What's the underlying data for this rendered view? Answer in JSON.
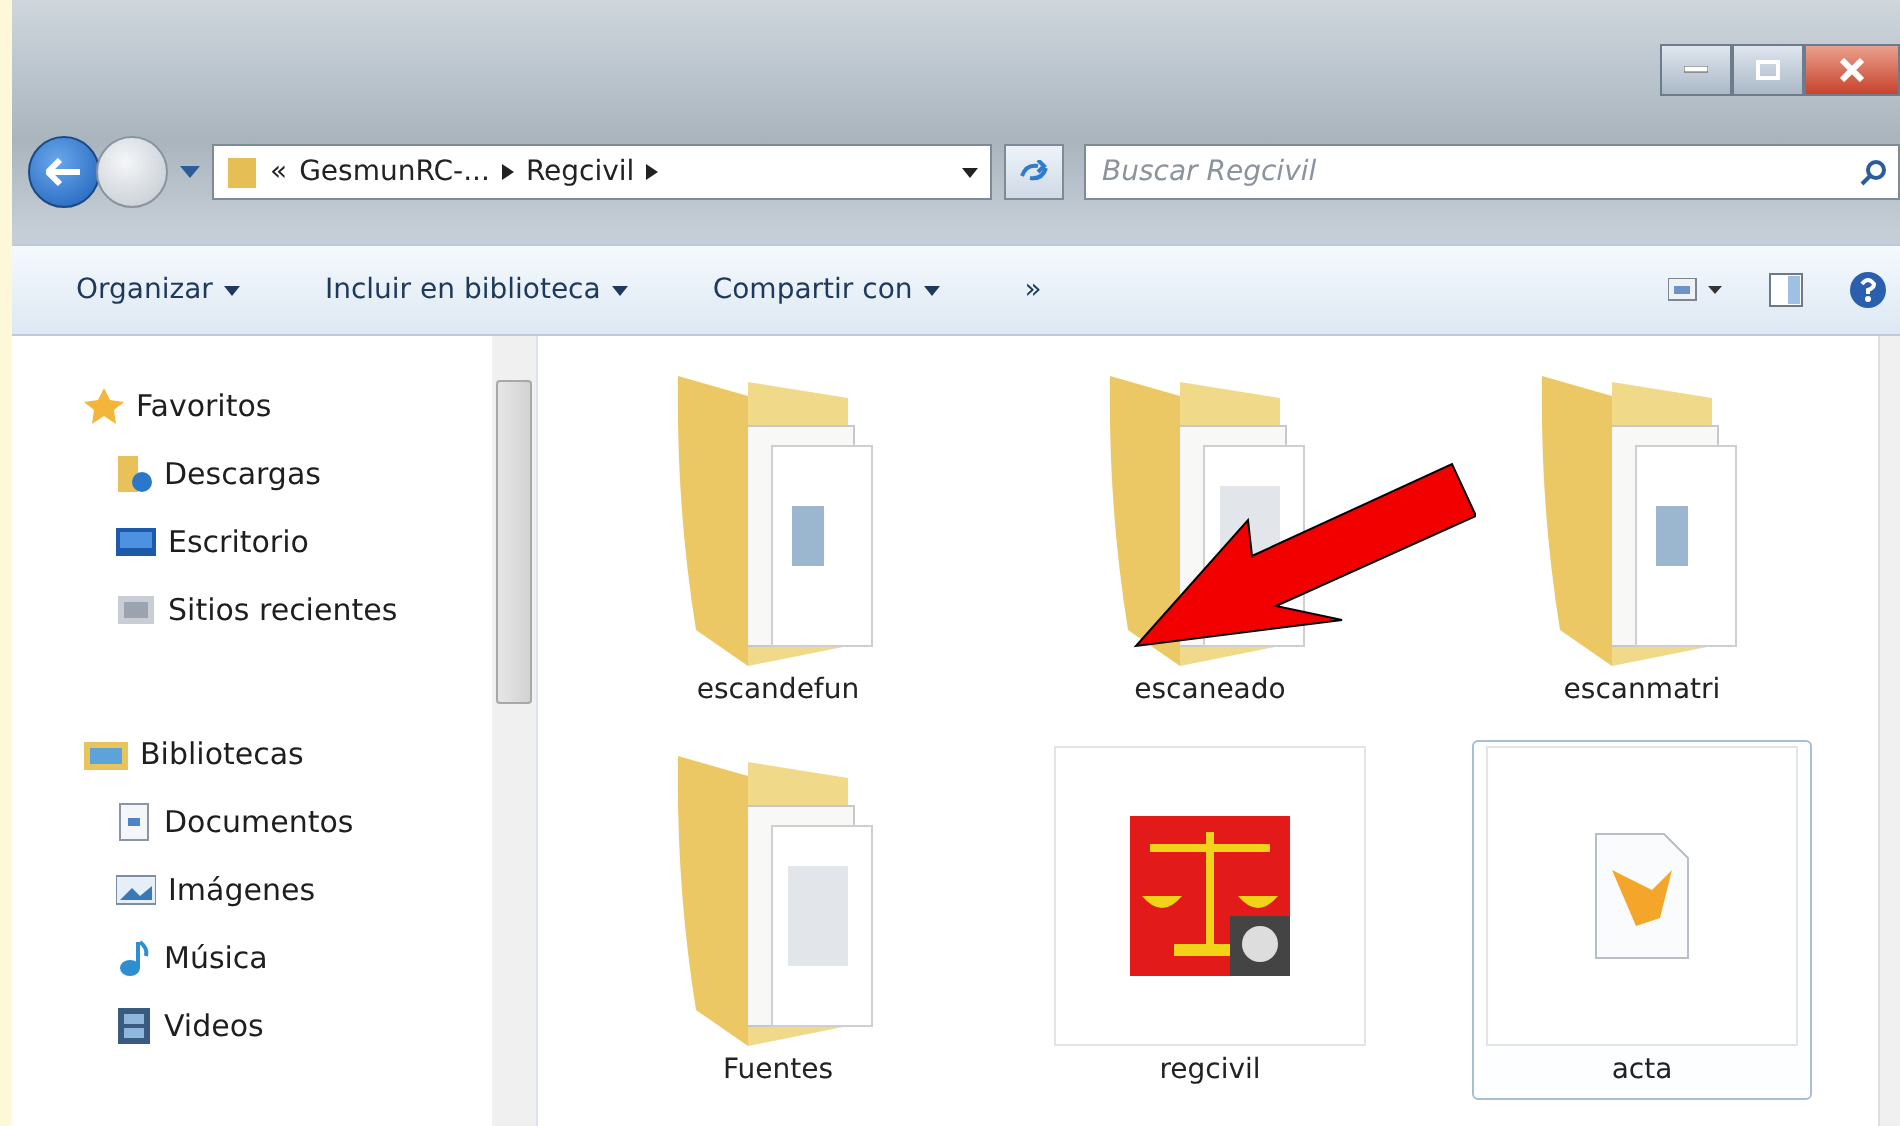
{
  "address": {
    "overflow": "«",
    "crumbs": [
      "GesmunRC-...",
      "Regcivil"
    ]
  },
  "search": {
    "placeholder": "Buscar Regcivil"
  },
  "toolbar": {
    "items": [
      "Organizar",
      "Incluir en biblioteca",
      "Compartir con"
    ],
    "more": "»"
  },
  "sidebar": {
    "groups": [
      {
        "label": "Favoritos",
        "kind": "star",
        "children": [
          {
            "label": "Descargas",
            "kind": "downloads"
          },
          {
            "label": "Escritorio",
            "kind": "desktop"
          },
          {
            "label": "Sitios recientes",
            "kind": "recent"
          }
        ]
      },
      {
        "label": "Bibliotecas",
        "kind": "library",
        "children": [
          {
            "label": "Documentos",
            "kind": "documents"
          },
          {
            "label": "Imágenes",
            "kind": "images"
          },
          {
            "label": "Música",
            "kind": "music"
          },
          {
            "label": "Videos",
            "kind": "videos"
          }
        ]
      }
    ]
  },
  "items": [
    {
      "name": "escandefun",
      "kind": "folder",
      "selected": false
    },
    {
      "name": "escaneado",
      "kind": "folder",
      "selected": false
    },
    {
      "name": "escanmatri",
      "kind": "folder",
      "selected": false
    },
    {
      "name": "Fuentes",
      "kind": "folder",
      "selected": false
    },
    {
      "name": "regcivil",
      "kind": "app",
      "selected": false
    },
    {
      "name": "acta",
      "kind": "file",
      "selected": true
    }
  ]
}
